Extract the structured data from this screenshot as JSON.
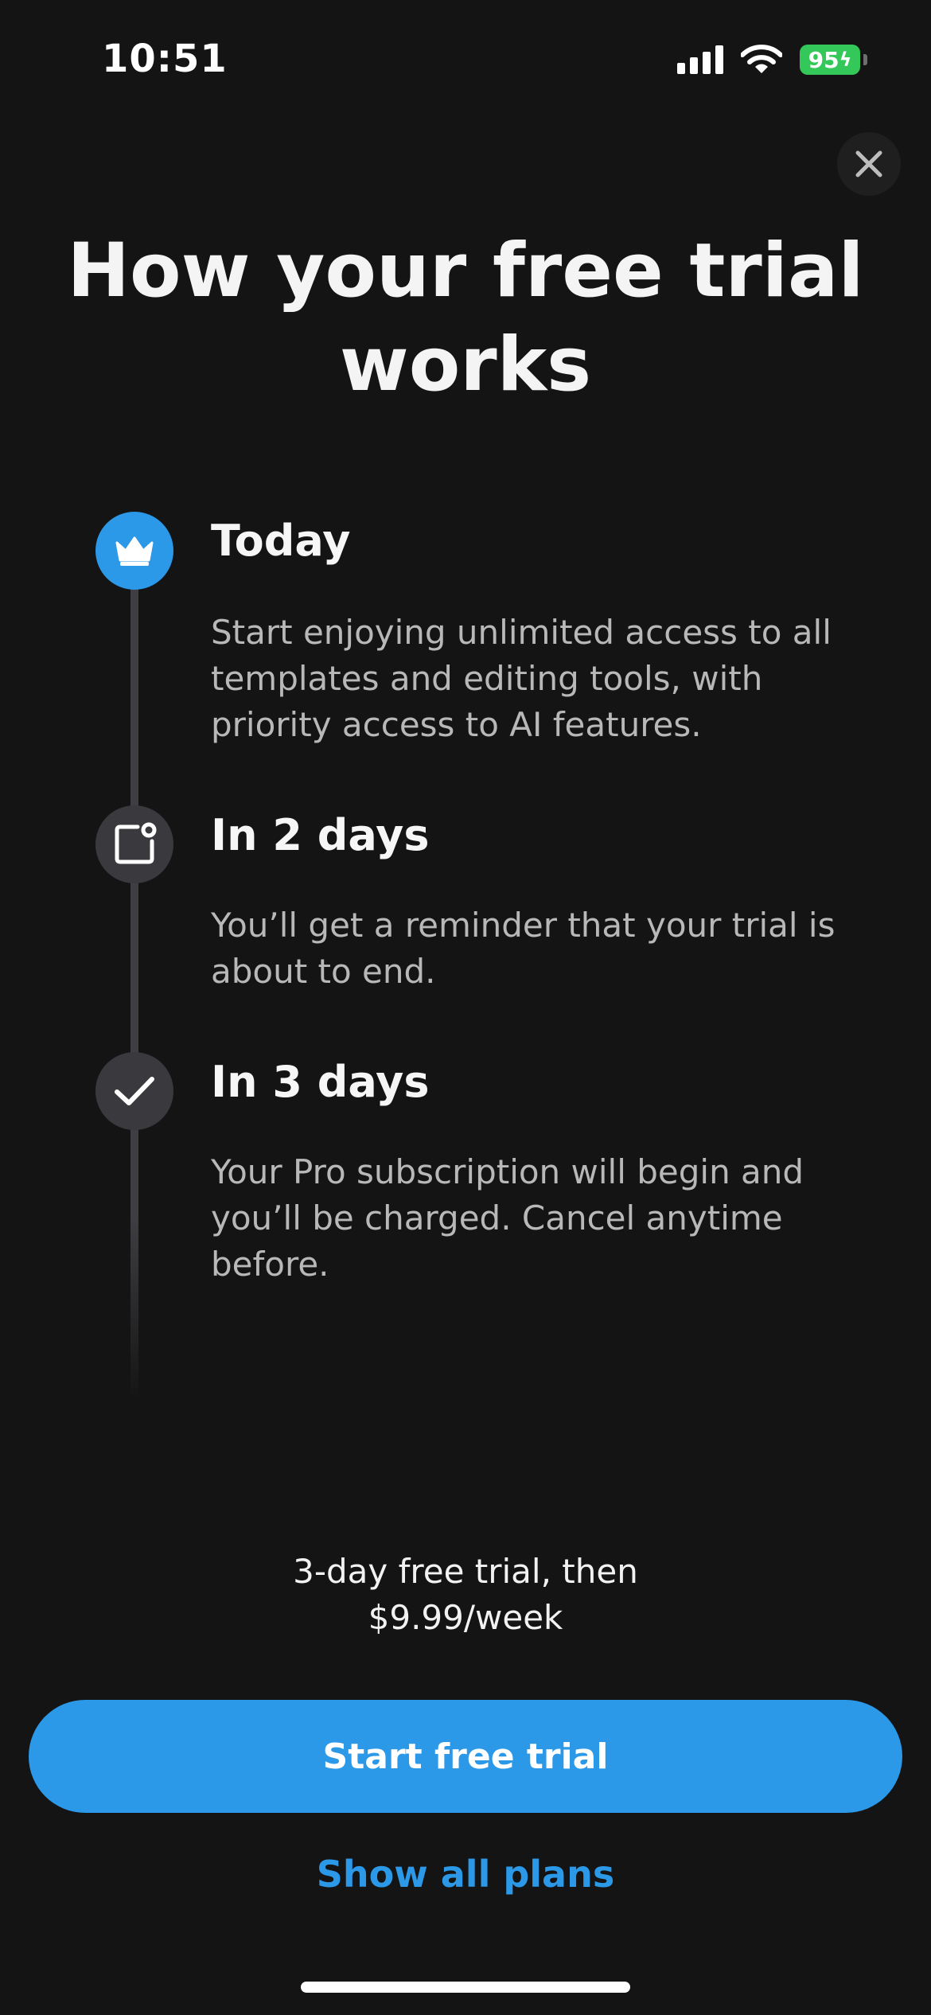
{
  "status_bar": {
    "time": "10:51",
    "battery": "95",
    "icons": [
      "signal-icon",
      "wifi-icon",
      "battery-icon"
    ]
  },
  "close_icon": "close-icon",
  "title": "How your free trial works",
  "steps": [
    {
      "icon": "crown-icon",
      "title": "Today",
      "description": "Start enjoying unlimited access to all templates and editing tools, with priority access to AI features."
    },
    {
      "icon": "notification-icon",
      "title": "In 2 days",
      "description": "You’ll get a reminder that your trial is about to end."
    },
    {
      "icon": "checkmark-icon",
      "title": "In 3 days",
      "description": "Your Pro subscription will begin and you’ll be charged. Cancel anytime before."
    }
  ],
  "pricing": {
    "line1": "3-day free trial, then",
    "line2": "$9.99/week"
  },
  "cta": {
    "primary_label": "Start free trial",
    "secondary_label": "Show all plans"
  },
  "colors": {
    "background": "#141414",
    "accent": "#2b98e8",
    "battery": "#34c759"
  }
}
